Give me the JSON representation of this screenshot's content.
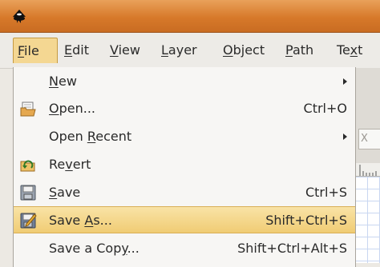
{
  "menubar": {
    "items": [
      {
        "label": "File",
        "mnemonic": "F",
        "rest": "ile"
      },
      {
        "label": "Edit",
        "mnemonic": "E",
        "rest": "dit"
      },
      {
        "label": "View",
        "mnemonic": "V",
        "rest": "iew"
      },
      {
        "label": "Layer",
        "mnemonic": "L",
        "rest": "ayer"
      },
      {
        "label": "Object",
        "mnemonic": "O",
        "rest": "bject"
      },
      {
        "label": "Path",
        "mnemonic": "P",
        "rest": "ath"
      },
      {
        "label": "Text",
        "pre": "Te",
        "mnemonic": "x",
        "rest": "t"
      }
    ],
    "active": "File"
  },
  "file_menu": {
    "items": [
      {
        "label": "New",
        "pre": "",
        "mnemonic": "N",
        "rest": "ew",
        "shortcut": "",
        "submenu": true,
        "icon": ""
      },
      {
        "label": "Open...",
        "pre": "",
        "mnemonic": "O",
        "rest": "pen...",
        "shortcut": "Ctrl+O",
        "submenu": false,
        "icon": "open-folder-icon"
      },
      {
        "label": "Open Recent",
        "pre": "Open ",
        "mnemonic": "R",
        "rest": "ecent",
        "shortcut": "",
        "submenu": true,
        "icon": ""
      },
      {
        "label": "Revert",
        "pre": "Re",
        "mnemonic": "v",
        "rest": "ert",
        "shortcut": "",
        "submenu": false,
        "icon": "revert-icon"
      },
      {
        "label": "Save",
        "pre": "",
        "mnemonic": "S",
        "rest": "ave",
        "shortcut": "Ctrl+S",
        "submenu": false,
        "icon": "save-disk-icon"
      },
      {
        "label": "Save As...",
        "pre": "Save ",
        "mnemonic": "A",
        "rest": "s...",
        "shortcut": "Shift+Ctrl+S",
        "submenu": false,
        "icon": "save-as-icon",
        "highlighted": true
      },
      {
        "label": "Save a Copy...",
        "pre": "Save a Cop",
        "mnemonic": "y",
        "rest": "...",
        "shortcut": "Shift+Ctrl+Alt+S",
        "submenu": false,
        "icon": ""
      }
    ]
  },
  "toolbar": {
    "input_fragment": "X"
  },
  "icons": {
    "app": "inkscape-logo-icon"
  },
  "colors": {
    "titlebar": "#d7792a",
    "highlight": "#f0cc74",
    "highlight_border": "#d9ae55",
    "grid": "#c9d7f1"
  }
}
